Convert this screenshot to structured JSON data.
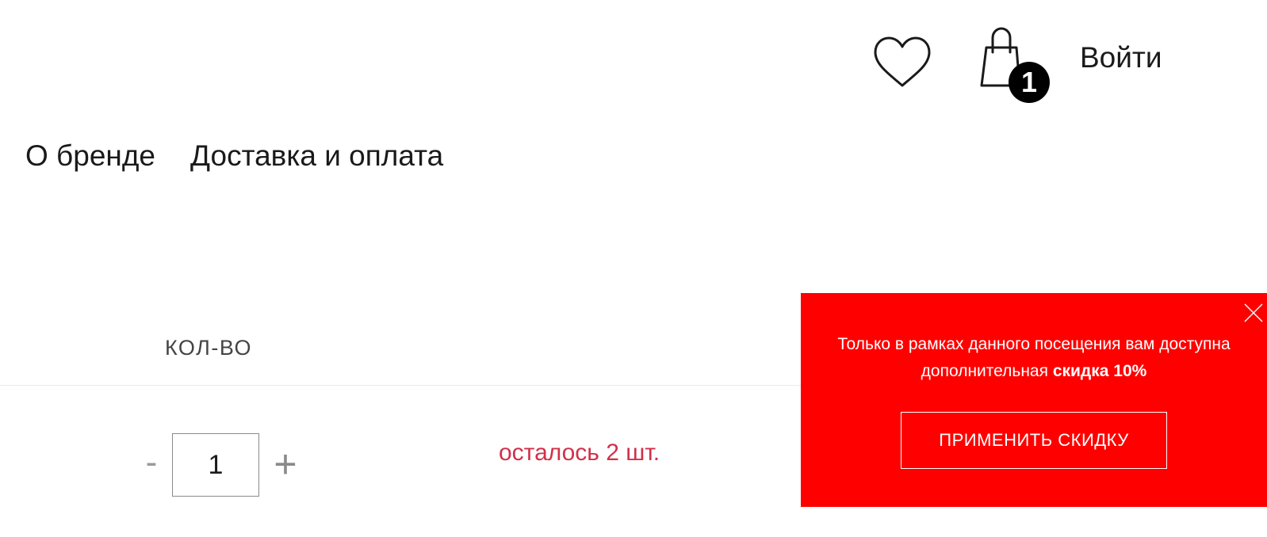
{
  "header": {
    "wishlist_icon": "heart-icon",
    "cart_icon": "shopping-bag-icon",
    "cart_count": "1",
    "login_label": "Войти"
  },
  "nav": {
    "items": [
      {
        "label": "О бренде"
      },
      {
        "label": "Доставка и оплата"
      }
    ]
  },
  "cart_item": {
    "quantity_header": "КОЛ-ВО",
    "minus_label": "-",
    "plus_label": "+",
    "quantity_value": "1",
    "stock_note": "осталось 2 шт."
  },
  "promo": {
    "text_part1": "Только в рамках данного посещения вам доступна дополнительная ",
    "text_highlight": "скидка 10%",
    "button_label": "ПРИМЕНИТЬ СКИДКУ",
    "close_icon": "close-icon",
    "background_color": "#ff0000"
  }
}
